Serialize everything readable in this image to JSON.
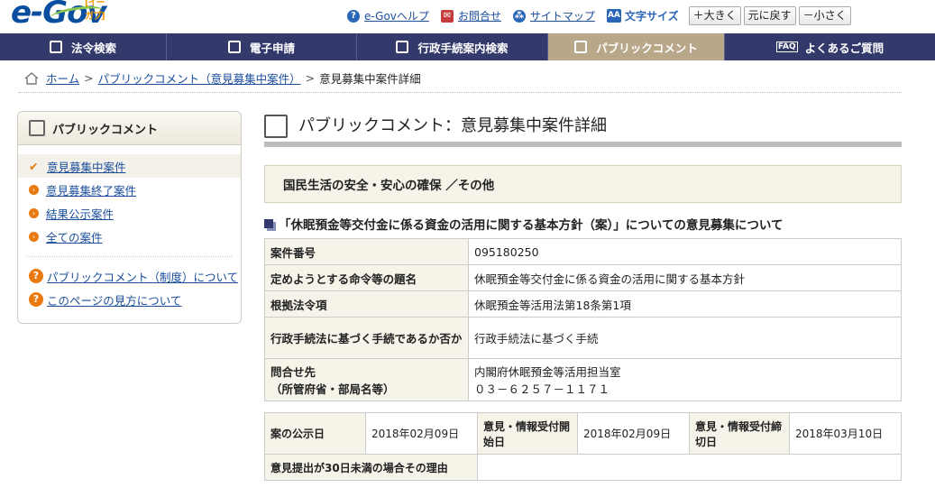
{
  "header": {
    "logo_main": "e-Gov",
    "logo_sub": "[イーガブ]",
    "help_label": "e-Govヘルプ",
    "contact_label": "お問合せ",
    "sitemap_label": "サイトマップ",
    "font_size_label": "文字サイズ",
    "font_larger": "＋大きく",
    "font_reset": "元に戻す",
    "font_smaller": "－小さく"
  },
  "nav": {
    "items": [
      {
        "label": "法令検索"
      },
      {
        "label": "電子申請"
      },
      {
        "label": "行政手続案内検索"
      },
      {
        "label": "パブリックコメント"
      },
      {
        "label": "よくあるご質問"
      }
    ],
    "faq_icon_text": "FAQ"
  },
  "breadcrumb": {
    "home": "ホーム",
    "parent": "パブリックコメント（意見募集中案件）",
    "current": "意見募集中案件詳細"
  },
  "sidebar": {
    "title": "パブリックコメント",
    "items": [
      {
        "label": "意見募集中案件"
      },
      {
        "label": "意見募集終了案件"
      },
      {
        "label": "結果公示案件"
      },
      {
        "label": "全ての案件"
      }
    ],
    "help_items": [
      {
        "label": "パブリックコメント（制度）について"
      },
      {
        "label": "このページの見方について"
      }
    ]
  },
  "main": {
    "title": "パブリックコメント：意見募集中案件詳細",
    "category": "国民生活の安全・安心の確保 ／その他",
    "subheading": "「休眠預金等交付金に係る資金の活用に関する基本方針（案）」についての意見募集について",
    "rows": [
      {
        "label": "案件番号",
        "value": "095180250"
      },
      {
        "label": "定めようとする命令等の題名",
        "value": "休眠預金等交付金に係る資金の活用に関する基本方針"
      },
      {
        "label": "根拠法令項",
        "value": "休眠預金等活用法第18条第1項"
      },
      {
        "label": "行政手続法に基づく手続であるか否か",
        "value": "行政手続法に基づく手続"
      },
      {
        "label": "問合せ先\n（所管府省・部局名等）",
        "value": "内閣府休眠預金等活用担当室\n０３－６２５７－１１７１"
      }
    ],
    "dates": {
      "announce_label": "案の公示日",
      "announce_value": "2018年02月09日",
      "start_label": "意見・情報受付開始日",
      "start_value": "2018年02月09日",
      "end_label": "意見・情報受付締切日",
      "end_value": "2018年03月10日",
      "reason_label": "意見提出が30日未満の場合その理由",
      "reason_value": ""
    }
  }
}
